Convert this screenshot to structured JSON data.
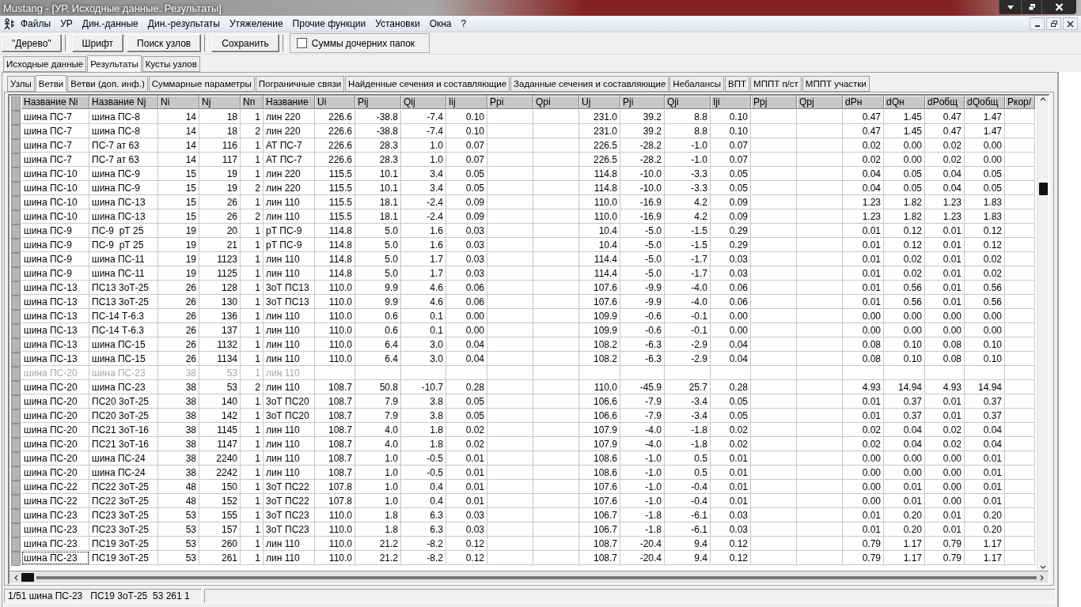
{
  "window": {
    "title": "Mustang - [УР. Исходные данные. Результаты]"
  },
  "menu": [
    "Файлы",
    "УР",
    "Дин.-данные",
    "Дин.-результаты",
    "Утяжеление",
    "Прочие функции",
    "Установки",
    "Окна",
    "?"
  ],
  "toolbar": {
    "buttons": [
      "\"Дерево\"",
      "Шрифт",
      "Поиск узлов",
      "Сохранить"
    ],
    "checkbox": {
      "label": "Суммы дочерних папок",
      "checked": false
    }
  },
  "outer_tabs": [
    {
      "label": "Исходные данные",
      "selected": false
    },
    {
      "label": "Результаты",
      "selected": true
    },
    {
      "label": "Кусты узлов",
      "selected": false
    }
  ],
  "inner_tabs": [
    {
      "label": "Узлы",
      "selected": false
    },
    {
      "label": "Ветви",
      "selected": true
    },
    {
      "label": "Ветви (доп. инф.)",
      "selected": false
    },
    {
      "label": "Суммарные параметры",
      "selected": false
    },
    {
      "label": "Пограничные связи",
      "selected": false
    },
    {
      "label": "Найденные сечения и составляющие",
      "selected": false
    },
    {
      "label": "Заданные сечения и составляющие",
      "selected": false
    },
    {
      "label": "Небалансы",
      "selected": false
    },
    {
      "label": "ВПТ",
      "selected": false
    },
    {
      "label": "МППТ п/ст",
      "selected": false
    },
    {
      "label": "МППТ участки",
      "selected": false
    }
  ],
  "table": {
    "columns": [
      {
        "label": "Название Ni",
        "kind": "text"
      },
      {
        "label": "Название Nj",
        "kind": "text"
      },
      {
        "label": "Ni",
        "kind": "number"
      },
      {
        "label": "Nj",
        "kind": "number"
      },
      {
        "label": "Nп",
        "kind": "number"
      },
      {
        "label": "Название",
        "kind": "text"
      },
      {
        "label": "Ui",
        "kind": "number"
      },
      {
        "label": "Pij",
        "kind": "number"
      },
      {
        "label": "Qij",
        "kind": "number"
      },
      {
        "label": "Iij",
        "kind": "number"
      },
      {
        "label": "Ppi",
        "kind": "number"
      },
      {
        "label": "Qpi",
        "kind": "number"
      },
      {
        "label": "Uj",
        "kind": "number"
      },
      {
        "label": "Pji",
        "kind": "number"
      },
      {
        "label": "Qji",
        "kind": "number"
      },
      {
        "label": "Iji",
        "kind": "number"
      },
      {
        "label": "Ppj",
        "kind": "number"
      },
      {
        "label": "Qpj",
        "kind": "number"
      },
      {
        "label": "dPн",
        "kind": "number"
      },
      {
        "label": "dQн",
        "kind": "number"
      },
      {
        "label": "dPобщ",
        "kind": "number"
      },
      {
        "label": "dQобщ",
        "kind": "number"
      },
      {
        "label": "Ркор/",
        "kind": "number"
      }
    ],
    "rows": [
      {
        "disabled": false,
        "focused": false,
        "cells": [
          "шина ПС-7",
          "шина ПС-8",
          "14",
          "18",
          "1",
          "лин 220",
          "226.6",
          "-38.8",
          "-7.4",
          "0.10",
          null,
          null,
          "231.0",
          "39.2",
          "8.8",
          "0.10",
          null,
          null,
          "0.47",
          "1.45",
          "0.47",
          "1.47"
        ]
      },
      {
        "disabled": false,
        "focused": false,
        "cells": [
          "шина ПС-7",
          "шина ПС-8",
          "14",
          "18",
          "2",
          "лин 220",
          "226.6",
          "-38.8",
          "-7.4",
          "0.10",
          null,
          null,
          "231.0",
          "39.2",
          "8.8",
          "0.10",
          null,
          null,
          "0.47",
          "1.45",
          "0.47",
          "1.47"
        ]
      },
      {
        "disabled": false,
        "focused": false,
        "cells": [
          "шина ПС-7",
          "ПС-7 ат 63",
          "14",
          "116",
          "1",
          "АТ ПС-7",
          "226.6",
          "28.3",
          "1.0",
          "0.07",
          null,
          null,
          "226.5",
          "-28.2",
          "-1.0",
          "0.07",
          null,
          null,
          "0.02",
          "0.00",
          "0.02",
          "0.00"
        ]
      },
      {
        "disabled": false,
        "focused": false,
        "cells": [
          "шина ПС-7",
          "ПС-7 ат 63",
          "14",
          "117",
          "1",
          "АТ ПС-7",
          "226.6",
          "28.3",
          "1.0",
          "0.07",
          null,
          null,
          "226.5",
          "-28.2",
          "-1.0",
          "0.07",
          null,
          null,
          "0.02",
          "0.00",
          "0.02",
          "0.00"
        ]
      },
      {
        "disabled": false,
        "focused": false,
        "cells": [
          "шина ПС-10",
          "шина ПС-9",
          "15",
          "19",
          "1",
          "лин 220",
          "115.5",
          "10.1",
          "3.4",
          "0.05",
          null,
          null,
          "114.8",
          "-10.0",
          "-3.3",
          "0.05",
          null,
          null,
          "0.04",
          "0.05",
          "0.04",
          "0.05"
        ]
      },
      {
        "disabled": false,
        "focused": false,
        "cells": [
          "шина ПС-10",
          "шина ПС-9",
          "15",
          "19",
          "2",
          "лин 220",
          "115.5",
          "10.1",
          "3.4",
          "0.05",
          null,
          null,
          "114.8",
          "-10.0",
          "-3.3",
          "0.05",
          null,
          null,
          "0.04",
          "0.05",
          "0.04",
          "0.05"
        ]
      },
      {
        "disabled": false,
        "focused": false,
        "cells": [
          "шина ПС-10",
          "шина ПС-13",
          "15",
          "26",
          "1",
          "лин 110",
          "115.5",
          "18.1",
          "-2.4",
          "0.09",
          null,
          null,
          "110.0",
          "-16.9",
          "4.2",
          "0.09",
          null,
          null,
          "1.23",
          "1.82",
          "1.23",
          "1.83"
        ]
      },
      {
        "disabled": false,
        "focused": false,
        "cells": [
          "шина ПС-10",
          "шина ПС-13",
          "15",
          "26",
          "2",
          "лин 110",
          "115.5",
          "18.1",
          "-2.4",
          "0.09",
          null,
          null,
          "110.0",
          "-16.9",
          "4.2",
          "0.09",
          null,
          null,
          "1.23",
          "1.82",
          "1.23",
          "1.83"
        ]
      },
      {
        "disabled": false,
        "focused": false,
        "cells": [
          "шина ПС-9",
          "ПС-9  рТ 25",
          "19",
          "20",
          "1",
          "рТ ПС-9",
          "114.8",
          "5.0",
          "1.6",
          "0.03",
          null,
          null,
          "10.4",
          "-5.0",
          "-1.5",
          "0.29",
          null,
          null,
          "0.01",
          "0.12",
          "0.01",
          "0.12"
        ]
      },
      {
        "disabled": false,
        "focused": false,
        "cells": [
          "шина ПС-9",
          "ПС-9  рТ 25",
          "19",
          "21",
          "1",
          "рТ ПС-9",
          "114.8",
          "5.0",
          "1.6",
          "0.03",
          null,
          null,
          "10.4",
          "-5.0",
          "-1.5",
          "0.29",
          null,
          null,
          "0.01",
          "0.12",
          "0.01",
          "0.12"
        ]
      },
      {
        "disabled": false,
        "focused": false,
        "cells": [
          "шина ПС-9",
          "шина ПС-11",
          "19",
          "1123",
          "1",
          "лин 110",
          "114.8",
          "5.0",
          "1.7",
          "0.03",
          null,
          null,
          "114.4",
          "-5.0",
          "-1.7",
          "0.03",
          null,
          null,
          "0.01",
          "0.02",
          "0.01",
          "0.02"
        ]
      },
      {
        "disabled": false,
        "focused": false,
        "cells": [
          "шина ПС-9",
          "шина ПС-11",
          "19",
          "1125",
          "1",
          "лин 110",
          "114.8",
          "5.0",
          "1.7",
          "0.03",
          null,
          null,
          "114.4",
          "-5.0",
          "-1.7",
          "0.03",
          null,
          null,
          "0.01",
          "0.02",
          "0.01",
          "0.02"
        ]
      },
      {
        "disabled": false,
        "focused": false,
        "cells": [
          "шина ПС-13",
          "ПС13 3оТ-25",
          "26",
          "128",
          "1",
          "3оТ ПС13",
          "110.0",
          "9.9",
          "4.6",
          "0.06",
          null,
          null,
          "107.6",
          "-9.9",
          "-4.0",
          "0.06",
          null,
          null,
          "0.01",
          "0.56",
          "0.01",
          "0.56"
        ]
      },
      {
        "disabled": false,
        "focused": false,
        "cells": [
          "шина ПС-13",
          "ПС13 3оТ-25",
          "26",
          "130",
          "1",
          "3оТ ПС13",
          "110.0",
          "9.9",
          "4.6",
          "0.06",
          null,
          null,
          "107.6",
          "-9.9",
          "-4.0",
          "0.06",
          null,
          null,
          "0.01",
          "0.56",
          "0.01",
          "0.56"
        ]
      },
      {
        "disabled": false,
        "focused": false,
        "cells": [
          "шина ПС-13",
          "ПС-14 Т-6.3",
          "26",
          "136",
          "1",
          "лин 110",
          "110.0",
          "0.6",
          "0.1",
          "0.00",
          null,
          null,
          "109.9",
          "-0.6",
          "-0.1",
          "0.00",
          null,
          null,
          "0.00",
          "0.00",
          "0.00",
          "0.00"
        ]
      },
      {
        "disabled": false,
        "focused": false,
        "cells": [
          "шина ПС-13",
          "ПС-14 Т-6.3",
          "26",
          "137",
          "1",
          "лин 110",
          "110.0",
          "0.6",
          "0.1",
          "0.00",
          null,
          null,
          "109.9",
          "-0.6",
          "-0.1",
          "0.00",
          null,
          null,
          "0.00",
          "0.00",
          "0.00",
          "0.00"
        ]
      },
      {
        "disabled": false,
        "focused": false,
        "cells": [
          "шина ПС-13",
          "шина ПС-15",
          "26",
          "1132",
          "1",
          "лин 110",
          "110.0",
          "6.4",
          "3.0",
          "0.04",
          null,
          null,
          "108.2",
          "-6.3",
          "-2.9",
          "0.04",
          null,
          null,
          "0.08",
          "0.10",
          "0.08",
          "0.10"
        ]
      },
      {
        "disabled": false,
        "focused": false,
        "cells": [
          "шина ПС-13",
          "шина ПС-15",
          "26",
          "1134",
          "1",
          "лин 110",
          "110.0",
          "6.4",
          "3.0",
          "0.04",
          null,
          null,
          "108.2",
          "-6.3",
          "-2.9",
          "0.04",
          null,
          null,
          "0.08",
          "0.10",
          "0.08",
          "0.10"
        ]
      },
      {
        "disabled": true,
        "focused": false,
        "cells": [
          "шина ПС-20",
          "шина ПС-23",
          "38",
          "53",
          "1",
          "лин 110",
          null,
          null,
          null,
          null,
          null,
          null,
          null,
          null,
          null,
          null,
          null,
          null,
          null,
          null,
          null,
          null
        ]
      },
      {
        "disabled": false,
        "focused": false,
        "cells": [
          "шина ПС-20",
          "шина ПС-23",
          "38",
          "53",
          "2",
          "лин 110",
          "108.7",
          "50.8",
          "-10.7",
          "0.28",
          null,
          null,
          "110.0",
          "-45.9",
          "25.7",
          "0.28",
          null,
          null,
          "4.93",
          "14.94",
          "4.93",
          "14.94"
        ]
      },
      {
        "disabled": false,
        "focused": false,
        "cells": [
          "шина ПС-20",
          "ПС20 3оТ-25",
          "38",
          "140",
          "1",
          "3оТ ПС20",
          "108.7",
          "7.9",
          "3.8",
          "0.05",
          null,
          null,
          "106.6",
          "-7.9",
          "-3.4",
          "0.05",
          null,
          null,
          "0.01",
          "0.37",
          "0.01",
          "0.37"
        ]
      },
      {
        "disabled": false,
        "focused": false,
        "cells": [
          "шина ПС-20",
          "ПС20 3оТ-25",
          "38",
          "142",
          "1",
          "3оТ ПС20",
          "108.7",
          "7.9",
          "3.8",
          "0.05",
          null,
          null,
          "106.6",
          "-7.9",
          "-3.4",
          "0.05",
          null,
          null,
          "0.01",
          "0.37",
          "0.01",
          "0.37"
        ]
      },
      {
        "disabled": false,
        "focused": false,
        "cells": [
          "шина ПС-20",
          "ПС21 3оТ-16",
          "38",
          "1145",
          "1",
          "лин 110",
          "108.7",
          "4.0",
          "1.8",
          "0.02",
          null,
          null,
          "107.9",
          "-4.0",
          "-1.8",
          "0.02",
          null,
          null,
          "0.02",
          "0.04",
          "0.02",
          "0.04"
        ]
      },
      {
        "disabled": false,
        "focused": false,
        "cells": [
          "шина ПС-20",
          "ПС21 3оТ-16",
          "38",
          "1147",
          "1",
          "лин 110",
          "108.7",
          "4.0",
          "1.8",
          "0.02",
          null,
          null,
          "107.9",
          "-4.0",
          "-1.8",
          "0.02",
          null,
          null,
          "0.02",
          "0.04",
          "0.02",
          "0.04"
        ]
      },
      {
        "disabled": false,
        "focused": false,
        "cells": [
          "шина ПС-20",
          "шина ПС-24",
          "38",
          "2240",
          "1",
          "лин 110",
          "108.7",
          "1.0",
          "-0.5",
          "0.01",
          null,
          null,
          "108.6",
          "-1.0",
          "0.5",
          "0.01",
          null,
          null,
          "0.00",
          "0.00",
          "0.00",
          "0.01"
        ]
      },
      {
        "disabled": false,
        "focused": false,
        "cells": [
          "шина ПС-20",
          "шина ПС-24",
          "38",
          "2242",
          "1",
          "лин 110",
          "108.7",
          "1.0",
          "-0.5",
          "0.01",
          null,
          null,
          "108.6",
          "-1.0",
          "0.5",
          "0.01",
          null,
          null,
          "0.00",
          "0.00",
          "0.00",
          "0.01"
        ]
      },
      {
        "disabled": false,
        "focused": false,
        "cells": [
          "шина ПС-22",
          "ПС22 3оТ-25",
          "48",
          "150",
          "1",
          "3оТ ПС22",
          "107.8",
          "1.0",
          "0.4",
          "0.01",
          null,
          null,
          "107.6",
          "-1.0",
          "-0.4",
          "0.01",
          null,
          null,
          "0.00",
          "0.01",
          "0.00",
          "0.01"
        ]
      },
      {
        "disabled": false,
        "focused": false,
        "cells": [
          "шина ПС-22",
          "ПС22 3оТ-25",
          "48",
          "152",
          "1",
          "3оТ ПС22",
          "107.8",
          "1.0",
          "0.4",
          "0.01",
          null,
          null,
          "107.6",
          "-1.0",
          "-0.4",
          "0.01",
          null,
          null,
          "0.00",
          "0.01",
          "0.00",
          "0.01"
        ]
      },
      {
        "disabled": false,
        "focused": false,
        "cells": [
          "шина ПС-23",
          "ПС23 3оТ-25",
          "53",
          "155",
          "1",
          "3оТ ПС23",
          "110.0",
          "1.8",
          "6.3",
          "0.03",
          null,
          null,
          "106.7",
          "-1.8",
          "-6.1",
          "0.03",
          null,
          null,
          "0.01",
          "0.20",
          "0.01",
          "0.20"
        ]
      },
      {
        "disabled": false,
        "focused": false,
        "cells": [
          "шина ПС-23",
          "ПС23 3оТ-25",
          "53",
          "157",
          "1",
          "3оТ ПС23",
          "110.0",
          "1.8",
          "6.3",
          "0.03",
          null,
          null,
          "106.7",
          "-1.8",
          "-6.1",
          "0.03",
          null,
          null,
          "0.01",
          "0.20",
          "0.01",
          "0.20"
        ]
      },
      {
        "disabled": false,
        "focused": false,
        "cells": [
          "шина ПС-23",
          "ПС19 3оТ-25",
          "53",
          "260",
          "1",
          "лин 110",
          "110.0",
          "21.2",
          "-8.2",
          "0.12",
          null,
          null,
          "108.7",
          "-20.4",
          "9.4",
          "0.12",
          null,
          null,
          "0.79",
          "1.17",
          "0.79",
          "1.17"
        ]
      },
      {
        "disabled": false,
        "focused": true,
        "cells": [
          "шина ПС-23",
          "ПС19 3оТ-25",
          "53",
          "261",
          "1",
          "лин 110",
          "110.0",
          "21.2",
          "-8.2",
          "0.12",
          null,
          null,
          "108.7",
          "-20.4",
          "9.4",
          "0.12",
          null,
          null,
          "0.79",
          "1.17",
          "0.79",
          "1.17"
        ]
      }
    ]
  },
  "status_bar": {
    "text": "1/51 шина ПС-23   ПС19 3оТ-25  53 261 1"
  }
}
